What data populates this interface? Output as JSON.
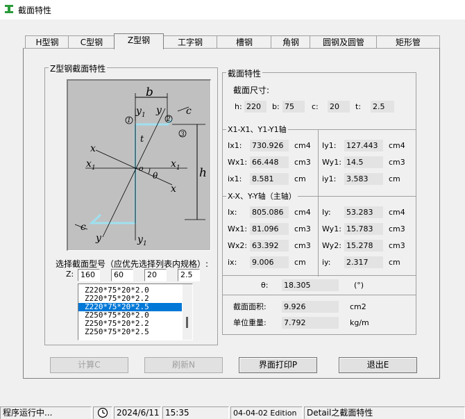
{
  "window": {
    "title": "截面特性"
  },
  "tabs": [
    "H型钢",
    "C型钢",
    "Z型钢",
    "工字钢",
    "槽钢",
    "角钢",
    "圆钢及圆管",
    "矩形管"
  ],
  "active_tab": "Z型钢",
  "left_group": {
    "title": "Z型钢截面特性",
    "diagram_labels": {
      "b": "b",
      "y1_top": "y",
      "y1_top_sub": "1",
      "y_top": "y",
      "c": "c",
      "p1": "1",
      "p2": "2",
      "p3": "3",
      "t": "t",
      "x": "x",
      "x1_left": "x",
      "x1_left_sub": "1",
      "o": "o",
      "theta": "θ",
      "x1_right": "x",
      "x1_right_sub": "1",
      "x_right": "x",
      "h": "h",
      "c_bottom": "c",
      "y_bottom": "y",
      "y1_bottom": "y",
      "y1_bottom_sub": "1"
    },
    "select_label": "选择截面型号（应优先选择列表内规格）:",
    "z_label": "Z:",
    "inputs": [
      "160",
      "60",
      "20",
      "2.5"
    ],
    "list_items": [
      "Z220*75*20*2.0",
      "Z220*75*20*2.2",
      "Z220*75*20*2.5",
      "Z250*75*20*2.0",
      "Z250*75*20*2.2",
      "Z250*75*20*2.5"
    ],
    "selected_index": 2
  },
  "right_group": {
    "title": "截面特性",
    "dims_label": "截面尺寸:",
    "dims": [
      {
        "label": "h:",
        "value": "220"
      },
      {
        "label": "b:",
        "value": "75"
      },
      {
        "label": "c:",
        "value": "20"
      },
      {
        "label": "t:",
        "value": "2.5"
      }
    ],
    "axis1_title": "X1-X1、Y1-Y1轴",
    "axis1_left": [
      {
        "label": "Ix1:",
        "value": "730.926",
        "unit": "cm4"
      },
      {
        "label": "Wx1:",
        "value": "66.448",
        "unit": "cm3"
      },
      {
        "label": "ix1:",
        "value": "8.581",
        "unit": "cm"
      }
    ],
    "axis1_right": [
      {
        "label": "Iy1:",
        "value": "127.443",
        "unit": "cm4"
      },
      {
        "label": "Wy1:",
        "value": "14.5",
        "unit": "cm3"
      },
      {
        "label": "iy1:",
        "value": "3.583",
        "unit": "cm"
      }
    ],
    "axis2_title": "X-X、Y-Y轴（主轴）",
    "axis2_left": [
      {
        "label": "Ix:",
        "value": "805.086",
        "unit": "cm4"
      },
      {
        "label": "Wx1:",
        "value": "81.096",
        "unit": "cm3"
      },
      {
        "label": "Wx2:",
        "value": "63.392",
        "unit": "cm3"
      },
      {
        "label": "ix:",
        "value": "9.006",
        "unit": "cm"
      }
    ],
    "axis2_right": [
      {
        "label": "Iy:",
        "value": "53.283",
        "unit": "cm4"
      },
      {
        "label": "Wy1:",
        "value": "15.783",
        "unit": "cm3"
      },
      {
        "label": "Wy2:",
        "value": "15.278",
        "unit": "cm3"
      },
      {
        "label": "iy:",
        "value": "2.317",
        "unit": "cm"
      }
    ],
    "theta": {
      "label": "θ:",
      "value": "18.305",
      "unit": "(°)"
    },
    "area": {
      "label": "截面面积:",
      "value": "9.926",
      "unit": "cm2"
    },
    "weight": {
      "label": "单位重量:",
      "value": "7.792",
      "unit": "kg/m"
    }
  },
  "buttons": {
    "calc": "计算C",
    "refresh": "刷新N",
    "print": "界面打印P",
    "exit": "退出E"
  },
  "statusbar": {
    "status": "程序运行中...",
    "date": "2024/6/11",
    "time": "15:35",
    "edition": "04-04-02 Edition",
    "context": "Detail之截面特性"
  },
  "colors": {
    "steel_profile": "#9fe0f0",
    "selection": "#0078d7",
    "diagram_bg": "#c0c0c0"
  }
}
